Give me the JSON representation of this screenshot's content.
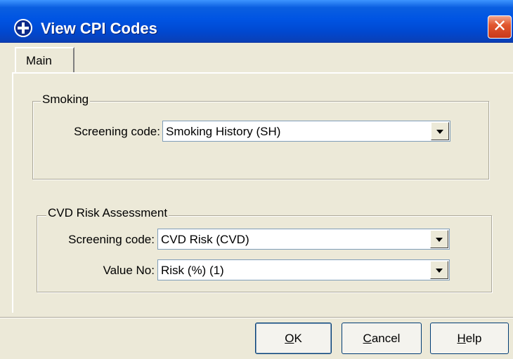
{
  "window": {
    "title": "View CPI Codes",
    "close_glyph": "✕"
  },
  "tabs": [
    {
      "label": "Main"
    }
  ],
  "smoking": {
    "group_label": "Smoking",
    "screening_label": "Screening code:",
    "screening_value": "Smoking History (SH)"
  },
  "cvd": {
    "group_label": "CVD Risk Assessment",
    "screening_label": "Screening code:",
    "screening_value": "CVD Risk (CVD)",
    "value_label": "Value No:",
    "value_value": "Risk (%) (1)"
  },
  "buttons": {
    "ok": {
      "mnemonic": "O",
      "rest": "K"
    },
    "cancel": {
      "mnemonic": "C",
      "rest": "ancel"
    },
    "help": {
      "mnemonic": "H",
      "rest": "elp"
    }
  },
  "icons": {
    "app": "plus-circle-icon",
    "close": "close-icon",
    "dropdown": "chevron-down-icon"
  }
}
